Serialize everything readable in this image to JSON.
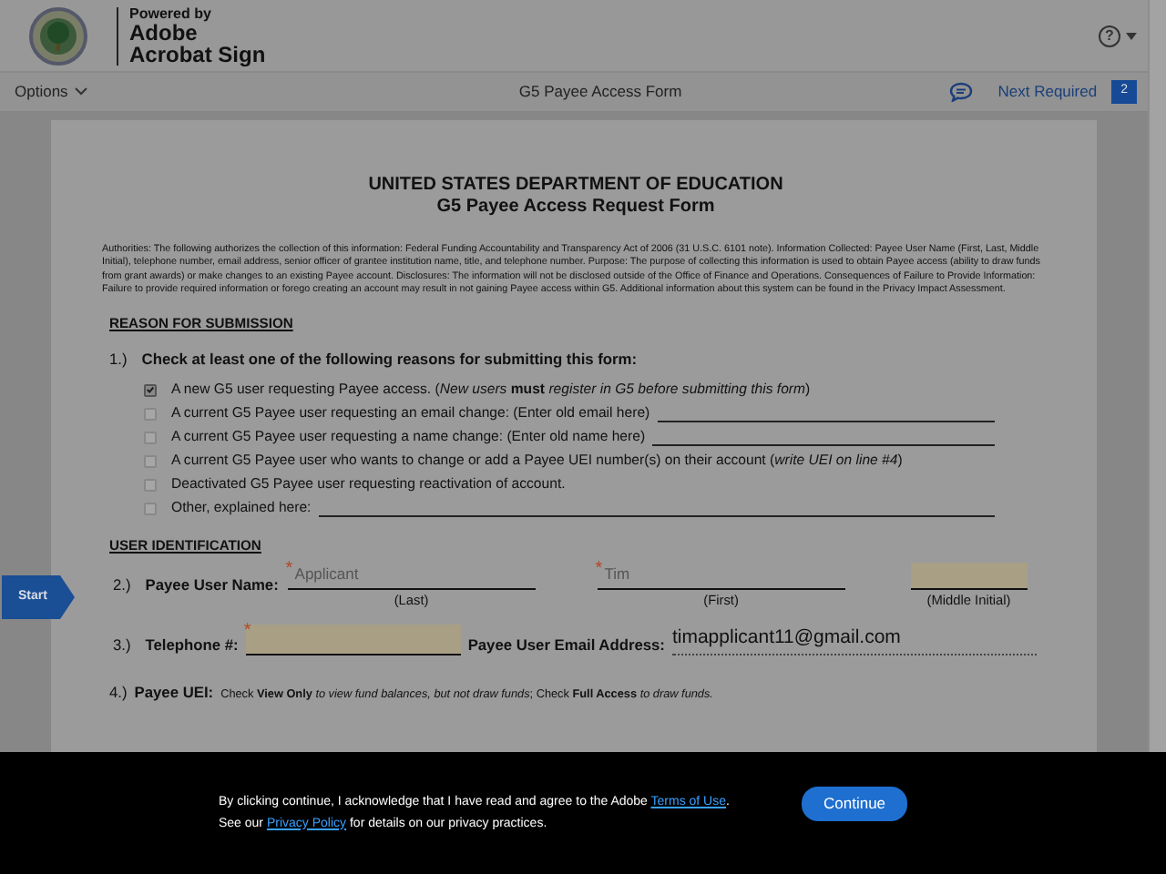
{
  "header": {
    "powered_by": "Powered by",
    "brand_lines": [
      "Adobe",
      "Acrobat Sign"
    ],
    "help_glyph": "?"
  },
  "toolbar": {
    "options": "Options",
    "title": "G5 Payee Access Form",
    "next_required": "Next Required",
    "count": "2"
  },
  "document": {
    "heading": "UNITED STATES DEPARTMENT OF EDUCATION",
    "subheading": "G5 Payee Access Request Form",
    "authorities": "Authorities: The following authorizes the collection of this information: Federal Funding Accountability and Transparency Act of 2006 (31 U.S.C. 6101 note). Information Collected: Payee User Name (First, Last, Middle Initial), telephone number, email address, senior officer of grantee institution name, title, and telephone number. Purpose: The purpose of collecting this information is used to obtain Payee access (ability to draw funds from grant awards) or make changes to an existing Payee account. Disclosures: The information will not be disclosed outside of the Office of Finance and Operations. Consequences of Failure to Provide Information: Failure to provide required information or forego creating an account may result in not gaining Payee access within G5. Additional information about this system can be found in the Privacy Impact Assessment.",
    "section_reason": "REASON FOR SUBMISSION",
    "q1": {
      "number": "1.)",
      "label": "Check at least one of the following reasons for submitting this form:"
    },
    "reasons": [
      {
        "text": "A new G5 user requesting Payee access. (*New users* **must** *register in G5 before submitting this form*)",
        "checked": true,
        "fill_line": false
      },
      {
        "text": "A current G5 Payee user requesting an email change: (Enter old email here)",
        "checked": false,
        "fill_line": true
      },
      {
        "text": "A current G5 Payee user requesting a name change: (Enter old name here)",
        "checked": false,
        "fill_line": true
      },
      {
        "text": "A current G5 Payee user who wants to change or add a Payee UEI number(s) on their account  (*write UEI on line #4*)",
        "checked": false,
        "fill_line": false
      },
      {
        "text": "Deactivated G5 Payee user requesting reactivation of account.",
        "checked": false,
        "fill_line": false
      },
      {
        "text": "Other, explained here:",
        "checked": false,
        "fill_line": true
      }
    ],
    "section_user": "USER IDENTIFICATION",
    "start_tab": "Start",
    "q2": {
      "number": "2.)",
      "label": "Payee User Name:",
      "fields": [
        {
          "placeholder": "Applicant",
          "caption": "(Last)",
          "required_mark": "*",
          "highlighted": false
        },
        {
          "placeholder": "Tim",
          "caption": "(First)",
          "required_mark": "*",
          "highlighted": false
        },
        {
          "caption": "(Middle Initial)",
          "highlighted": true
        }
      ]
    },
    "q3": {
      "number": "3.)",
      "label": "Telephone #:",
      "phone_required_mark": "*",
      "phone_highlighted": true,
      "email_label": "Payee User Email Address:",
      "email_value": "timapplicant11@gmail.com"
    },
    "q4": {
      "number": "4.)",
      "label": "Payee UEI:",
      "text": "Check **View Only** *to view fund balances, but not draw funds*; Check **Full Access** *to draw funds.*"
    }
  },
  "consent": {
    "parts": [
      {
        "kind": "text",
        "text": "By clicking continue, I acknowledge that I have read and agree to the Adobe "
      },
      {
        "kind": "link",
        "text": "Terms of Use"
      },
      {
        "kind": "text",
        "text": ". See our "
      },
      {
        "kind": "link",
        "text": "Privacy Policy"
      },
      {
        "kind": "text",
        "text": " for details on our privacy practices."
      }
    ],
    "button": "Continue"
  }
}
